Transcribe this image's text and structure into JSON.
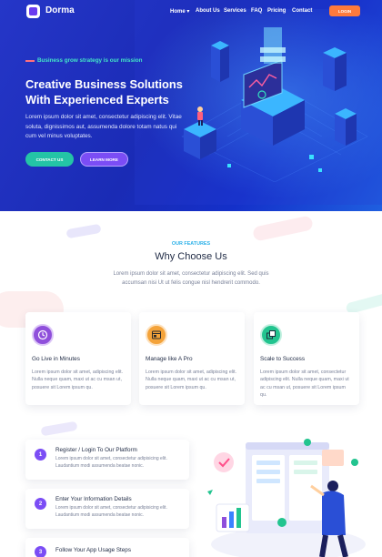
{
  "nav": {
    "brand": "Dorma",
    "items": [
      {
        "label": "Home ▾"
      },
      {
        "label": "About Us"
      },
      {
        "label": "Services"
      },
      {
        "label": "FAQ"
      },
      {
        "label": "Pricing"
      },
      {
        "label": "Contact"
      }
    ],
    "login_label": "LOGIN"
  },
  "hero": {
    "tagline": "Business grow strategy is our mission",
    "title": "Creative Business Solutions With Experienced Experts",
    "text": "Lorem ipsum dolor sit amet, consectetur adipiscing elit. Vitae soluta, dignissimos aut, assumenda dolore totam natus qui cum vel minus voluptates.",
    "contact_label": "CONTACT US",
    "learn_label": "LEARN MORE"
  },
  "features": {
    "eyebrow": "OUR FEATURES",
    "title": "Why Choose Us",
    "subtitle": "Lorem ipsum dolor sit amet, consectetur adipiscing elit. Sed quis accumsan nisi Ut ut felis congue nisl hendrerit commodo.",
    "cards": [
      {
        "title": "Go Live in Minutes",
        "text": "Lorem ipsum dolor sit amet, adipiscing elit. Nulla neque quam, maxi ut ac cu msan ut, posuere sit Lorem ipsum qu.",
        "icon": "clock-icon",
        "color": "#8f4fdb"
      },
      {
        "title": "Manage like A Pro",
        "text": "Lorem ipsum dolor sit amet, adipiscing elit. Nulla neque quam, maxi ut ac cu msan ut, posuere sit Lorem ipsum qu.",
        "icon": "window-icon",
        "color": "#f4a33a"
      },
      {
        "title": "Scale to Success",
        "text": "Lorem ipsum dolor sit amet, consectetur adipiscing elit. Nulla neque quam, maxi ut ac cu msan ut, posuere sit Lorem ipsum qu.",
        "icon": "layers-icon",
        "color": "#22c48f"
      }
    ]
  },
  "steps": [
    {
      "num": "1",
      "title": "Register / Login To Our Platform",
      "text": "Lorem ipsum dolor sit amet, consectetur adipisicing elit. Laudantium modi assumenda beatae nonic."
    },
    {
      "num": "2",
      "title": "Enter Your Information Details",
      "text": "Lorem ipsum dolor sit amet, consectetur adipisicing elit. Laudantium modi assumenda beatae nonic."
    },
    {
      "num": "3",
      "title": "Follow Your App Usage Steps",
      "text": ""
    }
  ]
}
